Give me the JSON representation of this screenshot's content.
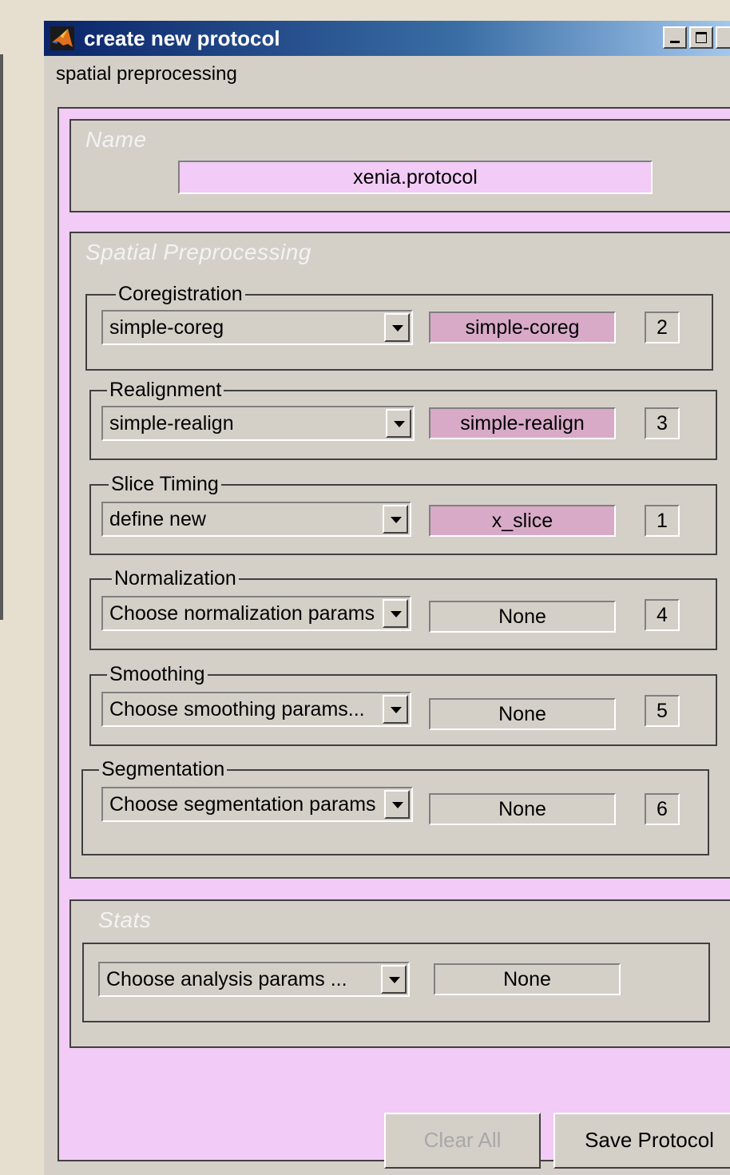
{
  "window": {
    "title": "create new protocol",
    "menu_label": "spatial preprocessing"
  },
  "name_panel": {
    "title": "Name",
    "value": "xenia.protocol"
  },
  "spatial_panel": {
    "title": "Spatial Preprocessing",
    "groups": [
      {
        "label": "Coregistration",
        "selected": "simple-coreg",
        "value": "simple-coreg",
        "order": "2",
        "state": "set"
      },
      {
        "label": "Realignment",
        "selected": "simple-realign",
        "value": "simple-realign",
        "order": "3",
        "state": "set"
      },
      {
        "label": "Slice Timing",
        "selected": "define new",
        "value": "x_slice",
        "order": "1",
        "state": "set"
      },
      {
        "label": "Normalization",
        "selected": "Choose normalization params .",
        "value": "None",
        "order": "4",
        "state": "none"
      },
      {
        "label": "Smoothing",
        "selected": "Choose smoothing params...",
        "value": "None",
        "order": "5",
        "state": "none"
      },
      {
        "label": "Segmentation",
        "selected": "Choose segmentation params .",
        "value": "None",
        "order": "6",
        "state": "none"
      }
    ]
  },
  "stats_panel": {
    "title": "Stats",
    "selected": "Choose analysis params ...",
    "value": "None"
  },
  "buttons": {
    "clear_all": "Clear All",
    "save_protocol": "Save Protocol"
  },
  "colors": {
    "content_bg": "#f2cbf6",
    "set_value_bg": "#d8aac8",
    "titlebar_start": "#0a246a",
    "titlebar_end": "#a6caf0"
  }
}
